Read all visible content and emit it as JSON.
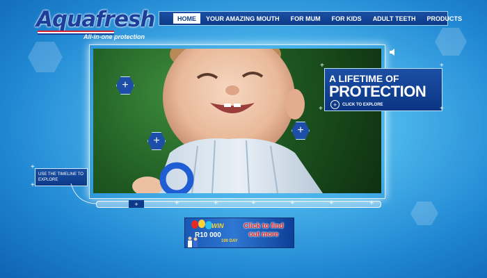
{
  "brand": {
    "name": "Aquafresh",
    "tagline": "All-in-one protection"
  },
  "nav": {
    "items": [
      {
        "label": "HOME",
        "active": true
      },
      {
        "label": "YOUR AMAZING MOUTH",
        "active": false
      },
      {
        "label": "FOR MUM",
        "active": false
      },
      {
        "label": "FOR KIDS",
        "active": false
      },
      {
        "label": "ADULT TEETH",
        "active": false
      },
      {
        "label": "PRODUCTS",
        "active": false
      }
    ]
  },
  "feature": {
    "headline_line1": "A LIFETIME OF",
    "headline_line2": "PROTECTION",
    "cta": "CLICK TO EXPLORE",
    "hotspot_icon": "plus-hexagon-icon"
  },
  "timeline": {
    "hint": "USE THE TIMELINE TO EXPLORE",
    "marker_icon": "plus-icon"
  },
  "promo": {
    "win": "WIN",
    "amount": "R10 000",
    "period": "100 DAY",
    "cta": "Click to find out more"
  },
  "colors": {
    "nav_bg": "#0c3a88",
    "accent_red": "#e52a25",
    "accent_yellow": "#ffd23a"
  }
}
